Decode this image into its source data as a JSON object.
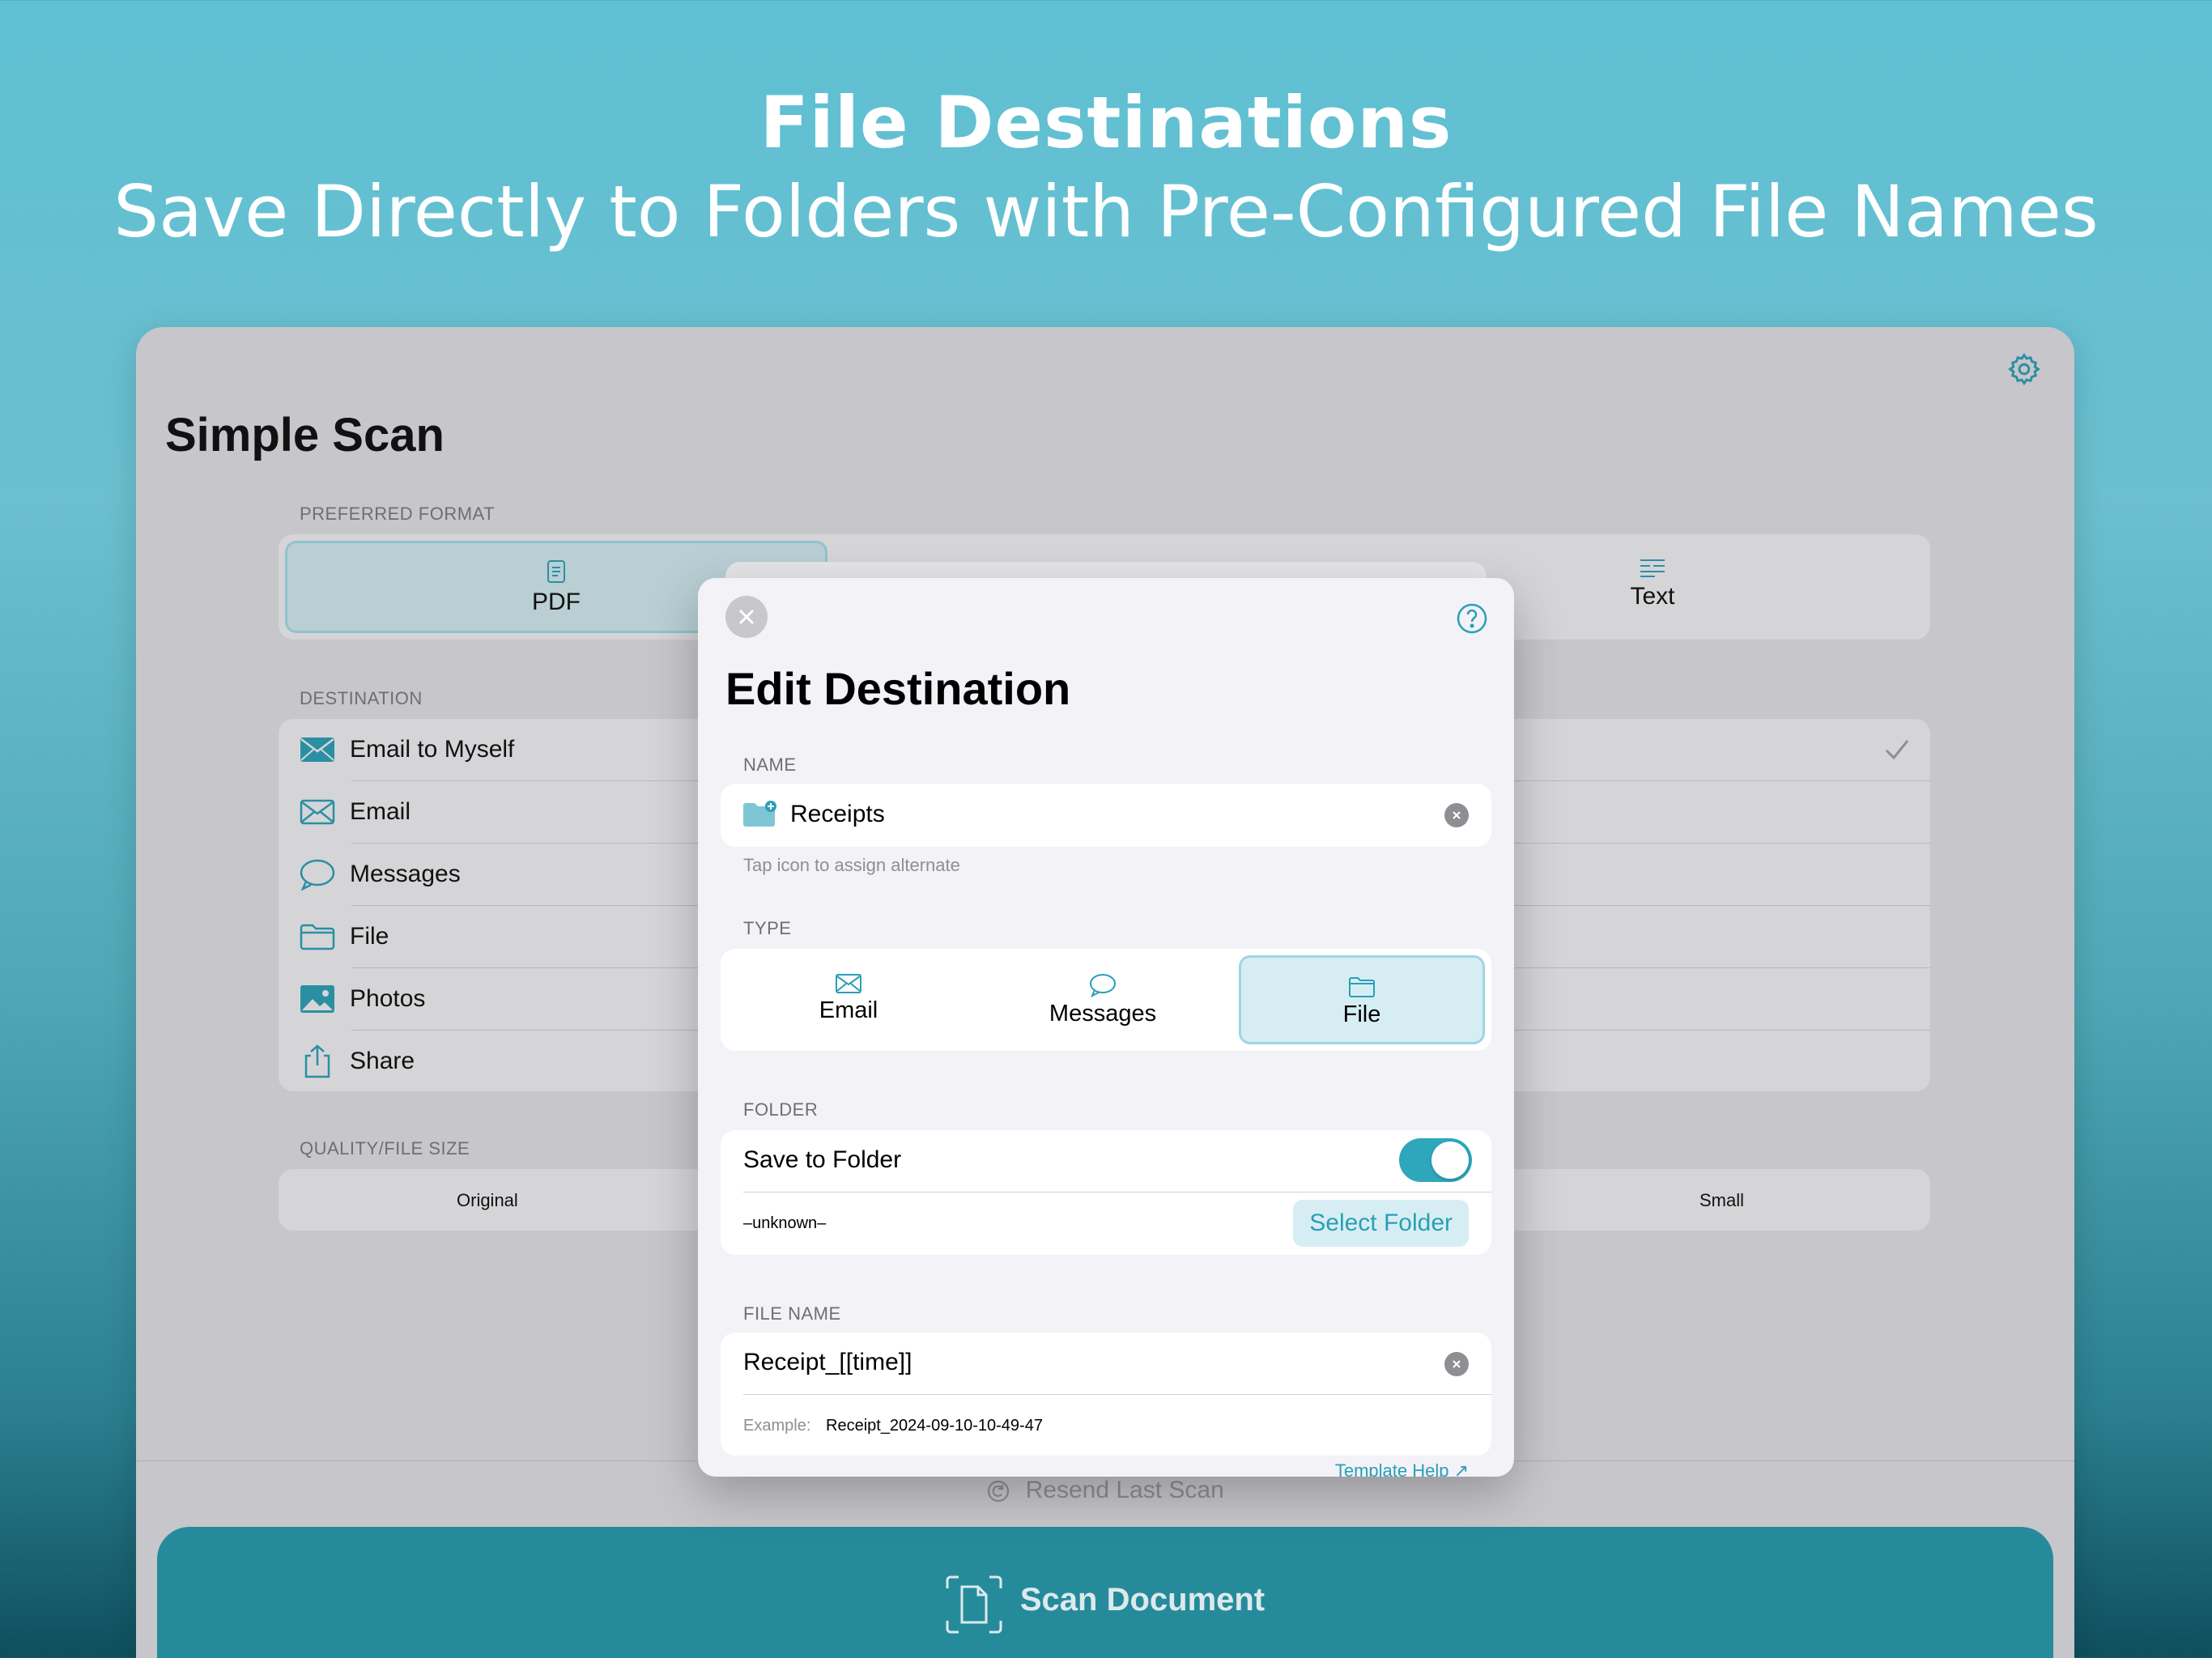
{
  "hero": {
    "title": "File Destinations",
    "subtitle": "Save Directly to Folders with Pre-Configured File Names"
  },
  "app": {
    "title": "Simple Scan",
    "settings_icon": "gear-icon",
    "preferred_format": {
      "label": "PREFERRED FORMAT",
      "options": [
        "PDF",
        "Text"
      ],
      "selected": "PDF"
    },
    "destination": {
      "label": "DESTINATION",
      "items": [
        {
          "label": "Email to Myself",
          "icon": "envelope-filled-icon",
          "checked": true
        },
        {
          "label": "Email",
          "icon": "envelope-icon"
        },
        {
          "label": "Messages",
          "icon": "message-bubble-icon"
        },
        {
          "label": "File",
          "icon": "folder-icon"
        },
        {
          "label": "Photos",
          "icon": "photo-icon"
        },
        {
          "label": "Share",
          "icon": "share-icon"
        }
      ]
    },
    "quality": {
      "label": "QUALITY/FILE SIZE",
      "left": "Original",
      "right": "Small"
    },
    "resend_label": "Resend Last Scan",
    "scan_label": "Scan Document"
  },
  "modal": {
    "title": "Edit Destination",
    "name_label": "NAME",
    "name_value": "Receipts",
    "name_hint": "Tap icon to assign alternate",
    "type_label": "TYPE",
    "types": [
      "Email",
      "Messages",
      "File"
    ],
    "type_selected": "File",
    "folder_label": "FOLDER",
    "save_to_folder": "Save to Folder",
    "save_to_folder_on": true,
    "folder_value": "–unknown–",
    "select_folder": "Select Folder",
    "file_name_label": "FILE NAME",
    "file_name_value": "Receipt_[[time]]",
    "example_label": "Example:",
    "example_value": "Receipt_2024-09-10-10-49-47",
    "template_help": "Template Help ↗"
  },
  "colors": {
    "accent": "#2a9fb5",
    "scan_button": "#258b9b",
    "overlay": "#c6c6cb"
  }
}
